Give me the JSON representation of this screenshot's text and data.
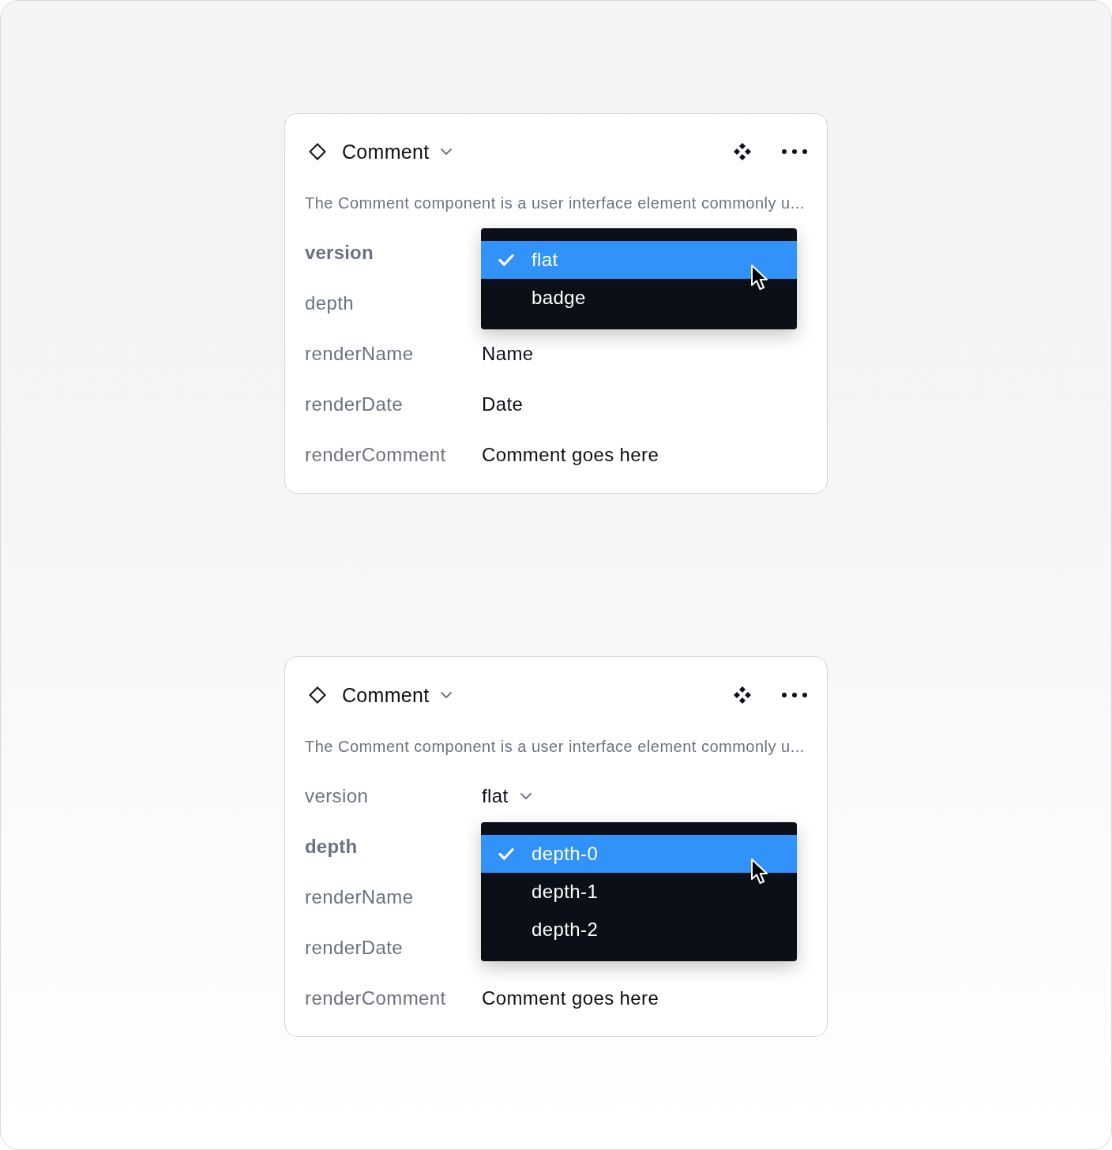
{
  "cards": [
    {
      "title": "Comment",
      "description": "The Comment component is a user interface element commonly u...",
      "properties": [
        {
          "label": "version",
          "open": true,
          "options": [
            {
              "label": "flat",
              "selected": true
            },
            {
              "label": "badge",
              "selected": false
            }
          ]
        },
        {
          "label": "depth",
          "open": false
        },
        {
          "label": "renderName",
          "open": false,
          "kind": "text",
          "value": "Name"
        },
        {
          "label": "renderDate",
          "open": false,
          "kind": "text",
          "value": "Date"
        },
        {
          "label": "renderComment",
          "open": false,
          "kind": "text",
          "value": "Comment goes here"
        }
      ]
    },
    {
      "title": "Comment",
      "description": "The Comment component is a user interface element commonly u...",
      "properties": [
        {
          "label": "version",
          "open": false,
          "kind": "select",
          "value": "flat"
        },
        {
          "label": "depth",
          "open": true,
          "options": [
            {
              "label": "depth-0",
              "selected": true
            },
            {
              "label": "depth-1",
              "selected": false
            },
            {
              "label": "depth-2",
              "selected": false
            }
          ]
        },
        {
          "label": "renderName",
          "open": false
        },
        {
          "label": "renderDate",
          "open": false
        },
        {
          "label": "renderComment",
          "open": false,
          "kind": "text",
          "value": "Comment goes here"
        }
      ]
    }
  ]
}
